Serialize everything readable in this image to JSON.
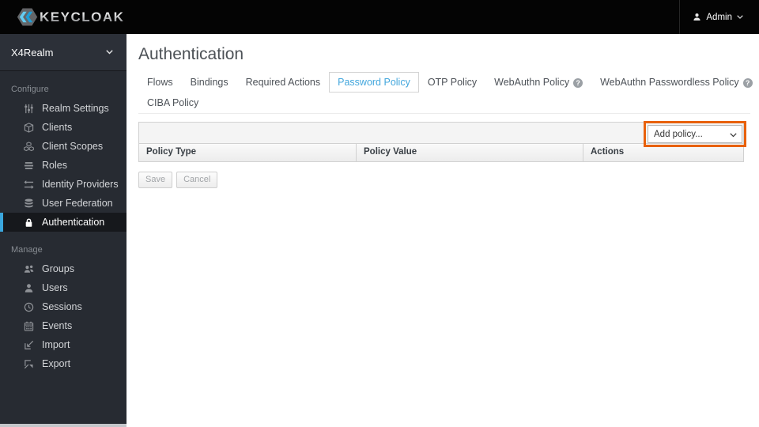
{
  "header": {
    "brand": "KEYCLOAK",
    "user": "Admin"
  },
  "sidebar": {
    "realm": "X4Realm",
    "sections": [
      {
        "label": "Configure",
        "items": [
          {
            "icon": "sliders-icon",
            "label": "Realm Settings"
          },
          {
            "icon": "cube-icon",
            "label": "Clients"
          },
          {
            "icon": "cubes-icon",
            "label": "Client Scopes"
          },
          {
            "icon": "list-icon",
            "label": "Roles"
          },
          {
            "icon": "exchange-icon",
            "label": "Identity Providers"
          },
          {
            "icon": "database-icon",
            "label": "User Federation"
          },
          {
            "icon": "lock-icon",
            "label": "Authentication",
            "active": true
          }
        ]
      },
      {
        "label": "Manage",
        "items": [
          {
            "icon": "groups-icon",
            "label": "Groups"
          },
          {
            "icon": "user-icon",
            "label": "Users"
          },
          {
            "icon": "clock-icon",
            "label": "Sessions"
          },
          {
            "icon": "calendar-icon",
            "label": "Events"
          },
          {
            "icon": "import-icon",
            "label": "Import"
          },
          {
            "icon": "export-icon",
            "label": "Export"
          }
        ]
      }
    ]
  },
  "main": {
    "title": "Authentication",
    "tabs": [
      {
        "label": "Flows"
      },
      {
        "label": "Bindings"
      },
      {
        "label": "Required Actions"
      },
      {
        "label": "Password Policy",
        "active": true
      },
      {
        "label": "OTP Policy"
      },
      {
        "label": "WebAuthn Policy",
        "help": true
      },
      {
        "label": "WebAuthn Passwordless Policy",
        "help": true
      },
      {
        "label": "CIBA Policy"
      }
    ],
    "icons": {
      "help_glyph": "?"
    },
    "toolbar": {
      "add_policy": "Add policy..."
    },
    "table": {
      "columns": [
        "Policy Type",
        "Policy Value",
        "Actions"
      ],
      "rows": []
    },
    "buttons": {
      "save": "Save",
      "cancel": "Cancel"
    }
  },
  "colors": {
    "highlight_box": "#e8610c",
    "active_tab_text": "#43a7dd",
    "nav_active_border": "#3aa6dd",
    "topbar_bg": "#040404",
    "sidebar_bg": "#272b32"
  }
}
